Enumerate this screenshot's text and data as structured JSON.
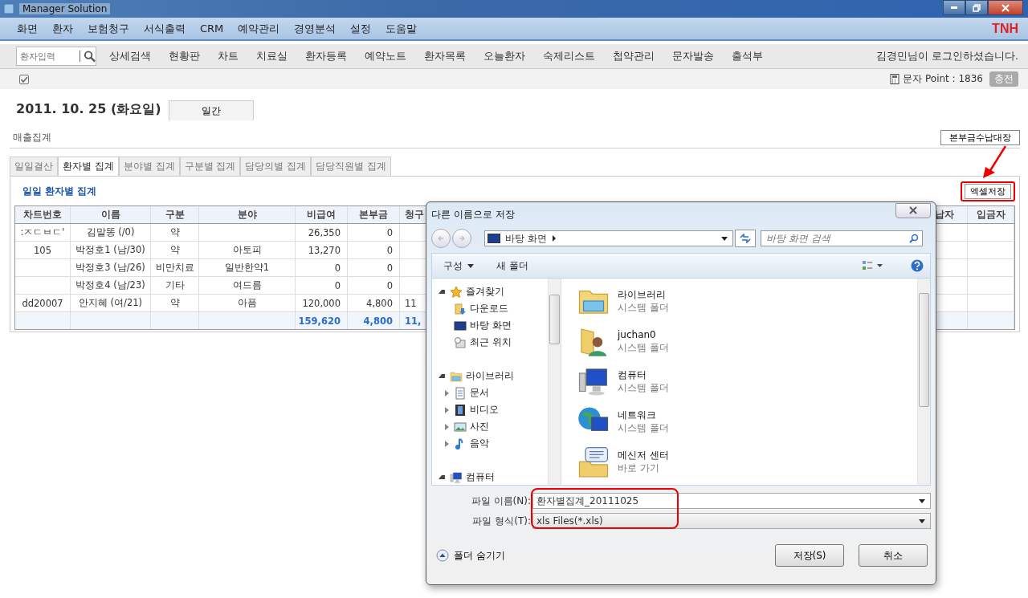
{
  "window": {
    "title": "Manager Solution"
  },
  "menu": [
    "화면",
    "환자",
    "보험청구",
    "서식출력",
    "CRM",
    "예약관리",
    "경영분석",
    "설정",
    "도움말"
  ],
  "brand": "TNH",
  "toolbar": {
    "search_placeholder": "환자입력",
    "items": [
      "상세검색",
      "현황판",
      "차트",
      "치료실",
      "환자등록",
      "예약노트",
      "환자목록",
      "오늘환자",
      "숙제리스트",
      "첩약관리",
      "문자발송",
      "출석부"
    ],
    "login_message": "김경민님이 로그인하셨습니다."
  },
  "status_row": {
    "checked": true,
    "sms_point": "문자 Point : 1836",
    "charge_button": "충전"
  },
  "date": "2011. 10. 25 (화요일)",
  "period_tab": "일간",
  "section_title": "매출집계",
  "ledger_button": "본부금수납대장",
  "tabs": [
    {
      "label": "일일결산",
      "selected": false
    },
    {
      "label": "환자별 집계",
      "selected": true
    },
    {
      "label": "분야별 집계",
      "selected": false
    },
    {
      "label": "구분별 집계",
      "selected": false
    },
    {
      "label": "담당의별 집계",
      "selected": false
    },
    {
      "label": "담당직원별 집계",
      "selected": false
    }
  ],
  "report": {
    "title": "일일 환자별 집계",
    "excel_button": "엑셀저장",
    "columns": [
      "차트번호",
      "이름",
      "구분",
      "분야",
      "비급여",
      "본부금",
      "청구"
    ],
    "right_columns": [
      "납자",
      "입금자"
    ],
    "rows": [
      {
        "cells": [
          ":ㅈㄷㅂㄷ'",
          "김말똥 (/0)",
          "약",
          null,
          "26,350",
          "0",
          null
        ]
      },
      {
        "cells": [
          "105",
          "박정호1 (남/30)",
          "약",
          "아토피",
          "13,270",
          "0",
          null
        ]
      },
      {
        "cells": [
          null,
          "박정호3 (남/26)",
          "비만치료",
          "일반한약1",
          "0",
          "0",
          null
        ]
      },
      {
        "cells": [
          null,
          "박정호4 (남/23)",
          "기타",
          "여드름",
          "0",
          "0",
          null
        ]
      },
      {
        "cells": [
          "dd20007",
          "안지혜 (여/21)",
          "약",
          "아픔",
          "120,000",
          "4,800",
          "11"
        ]
      }
    ],
    "total": [
      "159,620",
      "4,800",
      "11,"
    ]
  },
  "dialog": {
    "title": "다른 이름으로 저장",
    "address": "바탕 화면",
    "search_placeholder": "바탕 화면 검색",
    "organize": "구성",
    "new_folder": "새 폴더",
    "nav": [
      {
        "label": "즐겨찾기",
        "kind": "star",
        "expanded": true,
        "children": [
          {
            "label": "다운로드",
            "kind": "download"
          },
          {
            "label": "바탕 화면",
            "kind": "desktop"
          },
          {
            "label": "최근 위치",
            "kind": "recent"
          }
        ]
      },
      {
        "label": "라이브러리",
        "kind": "library",
        "expanded": true,
        "children": [
          {
            "label": "문서",
            "kind": "document",
            "expanded": false
          },
          {
            "label": "비디오",
            "kind": "video",
            "expanded": false
          },
          {
            "label": "사진",
            "kind": "picture",
            "expanded": false
          },
          {
            "label": "음악",
            "kind": "music",
            "expanded": false
          }
        ]
      },
      {
        "label": "컴퓨터",
        "kind": "computer",
        "expanded": true
      }
    ],
    "files": [
      {
        "name": "라이브러리",
        "type": "시스템 폴더",
        "kind": "library"
      },
      {
        "name": "juchan0",
        "type": "시스템 폴더",
        "kind": "user"
      },
      {
        "name": "컴퓨터",
        "type": "시스템 폴더",
        "kind": "computer"
      },
      {
        "name": "네트워크",
        "type": "시스템 폴더",
        "kind": "network"
      },
      {
        "name": "메신저 센터",
        "type": "바로 가기",
        "kind": "messenger"
      }
    ],
    "filename_label": "파일 이름(N):",
    "filename": "환자별집계_20111025",
    "filetype_label": "파일 형식(T):",
    "filetype": "xls Files(*.xls)",
    "hide_folders": "폴더 숨기기",
    "buttons": [
      "저장(S)",
      "취소"
    ]
  }
}
